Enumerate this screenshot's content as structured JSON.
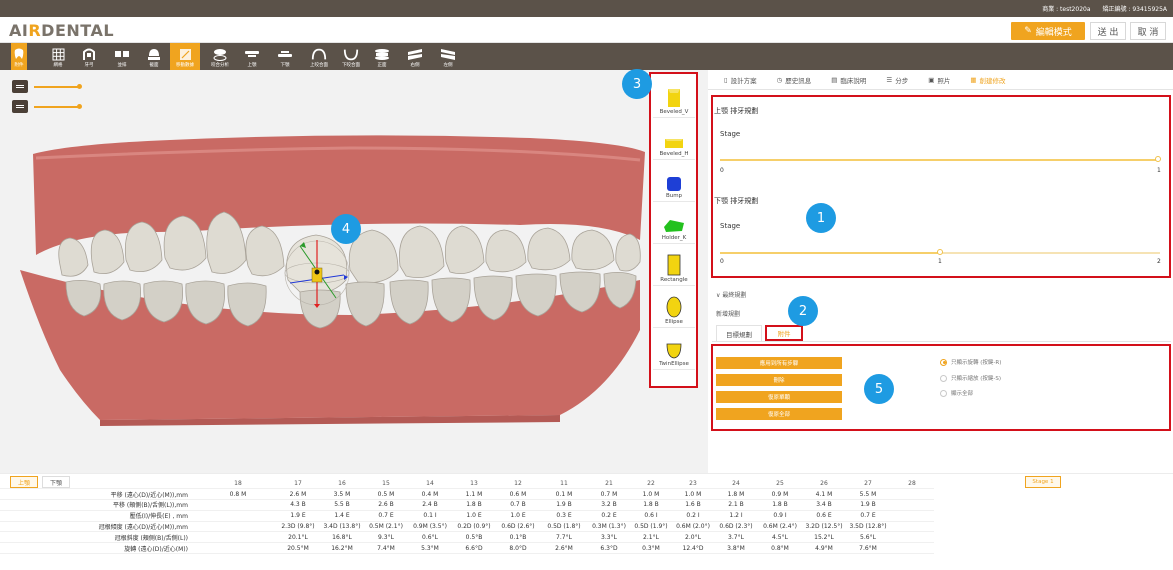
{
  "status_bar": {
    "doctor_label": "商業 : test2020a",
    "case_label": "矯正編號 : 93415925A"
  },
  "app": {
    "logo_pre": "AI",
    "logo_accent": "R",
    "logo_post": "DENTAL"
  },
  "header_buttons": {
    "edit_mode": "編輯模式",
    "send": "送 出",
    "cancel": "取 消"
  },
  "toolbar": [
    {
      "label": "附件",
      "icon": "tooth-icon",
      "active": false,
      "highlight": true
    },
    {
      "label": "網格",
      "icon": "grid-icon"
    },
    {
      "label": "牙弓",
      "icon": "arch-icon"
    },
    {
      "label": "並排",
      "icon": "side-by-side-icon"
    },
    {
      "label": "截面",
      "icon": "section-icon"
    },
    {
      "label": "移動數據",
      "icon": "move-data-icon",
      "active": true
    },
    {
      "label": "咬合分析",
      "icon": "occlusion-icon"
    },
    {
      "label": "上顎",
      "icon": "upper-jaw-icon"
    },
    {
      "label": "下顎",
      "icon": "lower-jaw-icon"
    },
    {
      "label": "上咬合面",
      "icon": "upper-occlusal-icon"
    },
    {
      "label": "下咬合面",
      "icon": "lower-occlusal-icon"
    },
    {
      "label": "正面",
      "icon": "front-icon"
    },
    {
      "label": "右側",
      "icon": "right-side-icon"
    },
    {
      "label": "左側",
      "icon": "left-side-icon"
    }
  ],
  "right_tabs": [
    {
      "label": "設計方案",
      "icon": "doc-icon"
    },
    {
      "label": "歷史訊息",
      "icon": "history-icon"
    },
    {
      "label": "臨床說明",
      "icon": "clinical-icon"
    },
    {
      "label": "分步",
      "icon": "steps-icon"
    },
    {
      "label": "照片",
      "icon": "photo-icon"
    },
    {
      "label": "創建修改",
      "icon": "create-icon",
      "active": true
    }
  ],
  "upper_plan": {
    "title": "上顎 排牙規劃",
    "stage_label": "Stage",
    "min": "0",
    "max": "1",
    "value": 1
  },
  "lower_plan": {
    "title": "下顎 排牙規劃",
    "stage_label": "Stage",
    "min": "0",
    "mid": "1",
    "max": "2",
    "value": 0.5
  },
  "final_plan": {
    "toggle_label": "最終規劃",
    "new_plan_label": "新增規劃",
    "sub_tabs": [
      "目標規劃",
      "附件"
    ]
  },
  "attachment_buttons": [
    "應用到所有步驟",
    "刪除",
    "復原單顆",
    "復原全部"
  ],
  "radio_options": [
    {
      "label": "只顯示旋轉 (按鍵-R)",
      "selected": true
    },
    {
      "label": "只顯示縮放 (按鍵-S)",
      "selected": false
    },
    {
      "label": "顯示全部",
      "selected": false
    }
  ],
  "attachments": [
    {
      "label": "Beveled_V",
      "color": "#f2d410"
    },
    {
      "label": "Beveled_H",
      "color": "#f2d410"
    },
    {
      "label": "Bump",
      "color": "#1e3fd6"
    },
    {
      "label": "Holder_K",
      "color": "#23c11e"
    },
    {
      "label": "Rectangle",
      "color": "#f2d410"
    },
    {
      "label": "Ellipse",
      "color": "#f2d410"
    },
    {
      "label": "TwinEllipse",
      "color": "#f2d410"
    }
  ],
  "badges": [
    "1",
    "2",
    "3",
    "4",
    "5"
  ],
  "table": {
    "jaw_tabs": [
      "上顎",
      "下顎"
    ],
    "stage_button": "Stage 1",
    "columns": [
      "18",
      "17",
      "16",
      "15",
      "14",
      "13",
      "12",
      "11",
      "21",
      "22",
      "23",
      "24",
      "25",
      "26",
      "27",
      "28"
    ],
    "rows": [
      {
        "label": "平移 (遠心(D)/近心(M)),mm",
        "values": [
          "0.8 M",
          "2.6 M",
          "3.5 M",
          "0.5 M",
          "0.4 M",
          "1.1 M",
          "0.6 M",
          "0.1 M",
          "0.7 M",
          "1.0 M",
          "1.0 M",
          "1.8 M",
          "0.9 M",
          "4.1 M",
          "5.5 M",
          ""
        ]
      },
      {
        "label": "平移 (頰側(B)/舌側(L)),mm",
        "values": [
          "",
          "4.3 B",
          "5.5 B",
          "2.6 B",
          "2.4 B",
          "1.8 B",
          "0.7 B",
          "1.9 B",
          "3.2 B",
          "1.8 B",
          "1.6 B",
          "2.1 B",
          "1.8 B",
          "3.4 B",
          "1.9 B",
          ""
        ]
      },
      {
        "label": "壓低(I)/伸長(E) , mm",
        "values": [
          "",
          "1.9 E",
          "1.4 E",
          "0.7 E",
          "0.1 I",
          "1.0 E",
          "1.0 E",
          "0.3 E",
          "0.2 E",
          "0.6 I",
          "0.2 I",
          "1.2 I",
          "0.9 I",
          "0.6 E",
          "0.7 E",
          ""
        ]
      },
      {
        "label": "冠根傾度 (遠心(D)/近心(M)),mm",
        "values": [
          "",
          "2.3D (9.8°)",
          "3.4D (13.8°)",
          "0.5M (2.1°)",
          "0.9M (3.5°)",
          "0.2D (0.9°)",
          "0.6D (2.6°)",
          "0.5D (1.8°)",
          "0.3M (1.3°)",
          "0.5D (1.9°)",
          "0.6M (2.0°)",
          "0.6D (2.3°)",
          "0.6M (2.4°)",
          "3.2D (12.5°)",
          "3.5D (12.8°)",
          ""
        ]
      },
      {
        "label": "冠根斜度 (頰側(B)/舌側(L))",
        "values": [
          "",
          "20.1°L",
          "16.8°L",
          "9.3°L",
          "0.6°L",
          "0.5°B",
          "0.1°B",
          "7.7°L",
          "3.3°L",
          "2.1°L",
          "2.0°L",
          "3.7°L",
          "4.5°L",
          "15.2°L",
          "5.6°L",
          ""
        ]
      },
      {
        "label": "旋轉 (遠心(D)/近心(M))",
        "values": [
          "",
          "20.5°M",
          "16.2°M",
          "7.4°M",
          "5.3°M",
          "6.6°D",
          "8.0°D",
          "2.6°M",
          "6.3°D",
          "0.3°M",
          "12.4°D",
          "3.8°M",
          "0.8°M",
          "4.9°M",
          "7.6°M",
          ""
        ]
      }
    ]
  },
  "colors": {
    "accent": "#f0a41f",
    "dark": "#5b5249",
    "annotation_red": "#d3101a",
    "badge_blue": "#1e9be2"
  }
}
